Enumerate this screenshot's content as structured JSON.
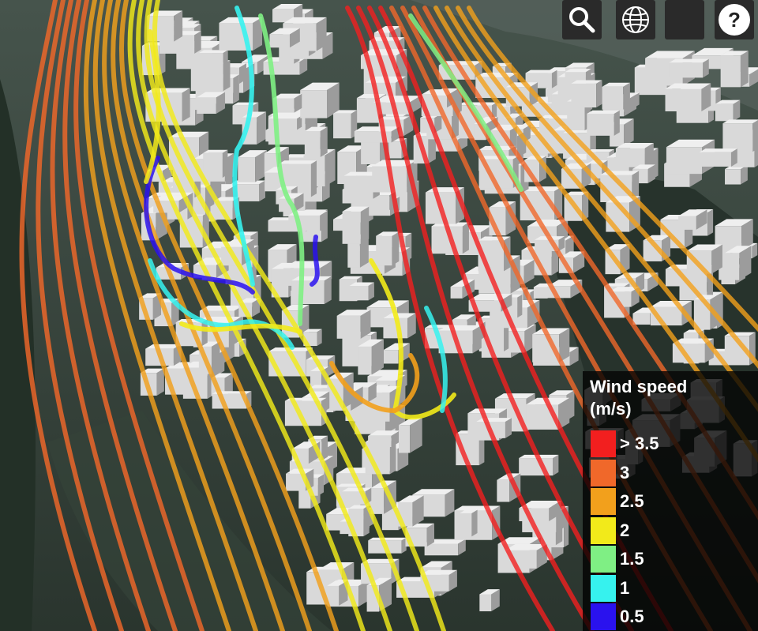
{
  "toolbar": {
    "search_icon": "search-icon",
    "globe_icon": "globe-icon",
    "help_icon": "help-icon",
    "help_glyph": "?"
  },
  "legend": {
    "title_line1": "Wind speed",
    "title_line2": "(m/s)",
    "entries": [
      {
        "label": "> 3.5",
        "color": "#f21f1f"
      },
      {
        "label": "3",
        "color": "#f0682a"
      },
      {
        "label": "2.5",
        "color": "#f2a01c"
      },
      {
        "label": "2",
        "color": "#f2ea1a"
      },
      {
        "label": "1.5",
        "color": "#7fef84"
      },
      {
        "label": "1",
        "color": "#36f2ee"
      },
      {
        "label": "0.5",
        "color": "#2a12ee"
      }
    ]
  },
  "map": {
    "layer": "3D buildings with wind streamlines",
    "building_color": "#d9d9d9",
    "terrain_color": "#2f3d35"
  }
}
